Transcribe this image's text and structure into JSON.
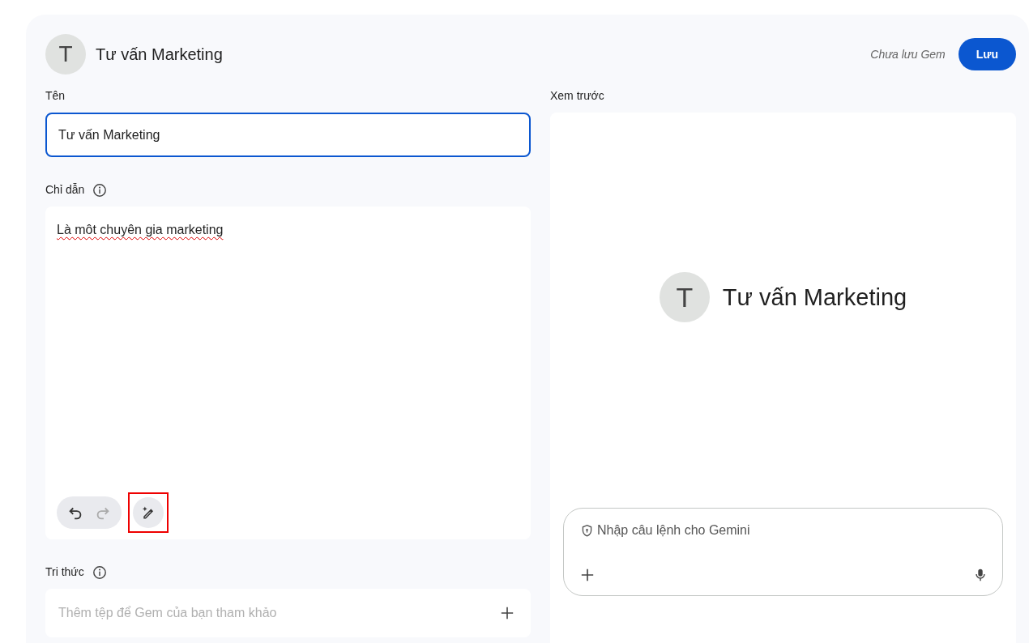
{
  "header": {
    "avatar_letter": "T",
    "title": "Tư vấn Marketing",
    "status": "Chưa lưu Gem",
    "save_button": "Lưu"
  },
  "name_field": {
    "label": "Tên",
    "value": "Tư vấn Marketing"
  },
  "instructions": {
    "label": "Chỉ dẫn",
    "value": "Là môt chuyên gia marketing",
    "tools": [
      {
        "kind": "undo",
        "disabled": false
      },
      {
        "kind": "redo",
        "disabled": true
      },
      {
        "kind": "magic",
        "disabled": false,
        "highlighted": true
      }
    ]
  },
  "knowledge": {
    "label": "Tri thức",
    "placeholder": "Thêm tệp để Gem của bạn tham khảo"
  },
  "preview": {
    "label": "Xem trước",
    "avatar_letter": "T",
    "title": "Tư vấn Marketing",
    "prompt_placeholder": "Nhập câu lệnh cho Gemini"
  }
}
